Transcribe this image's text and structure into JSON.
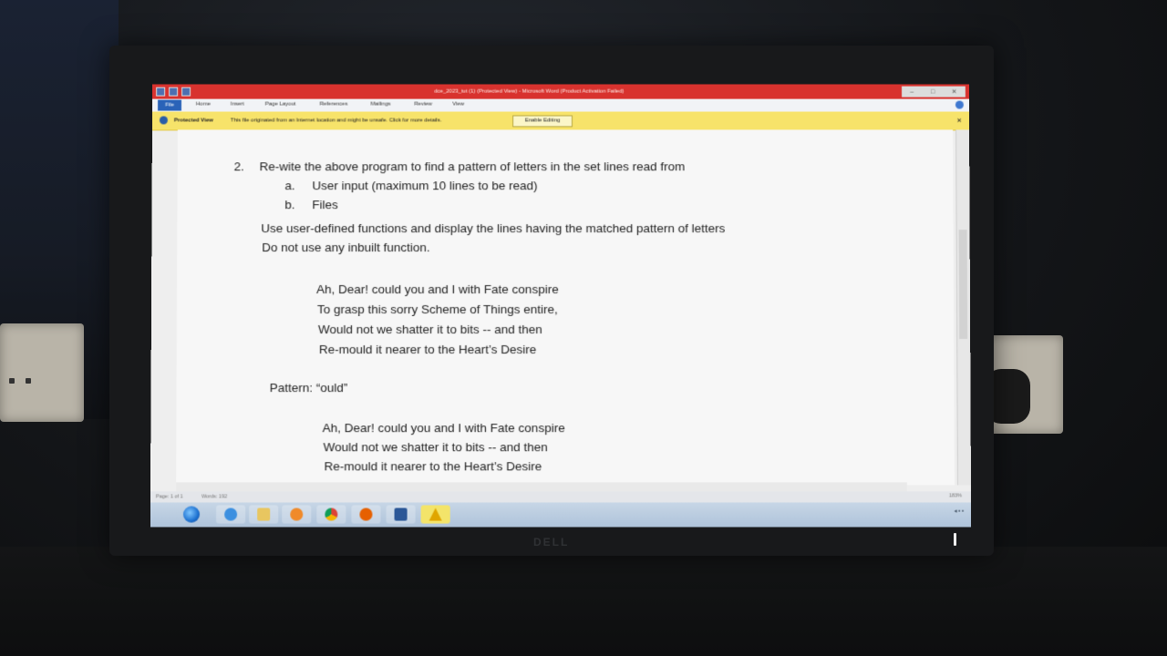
{
  "window": {
    "title": "dce_2023_tut (1) (Protected View) - Microsoft Word (Product Activation Failed)",
    "accent_color": "#d8322e"
  },
  "ribbon": {
    "tabs": [
      "File",
      "Home",
      "Insert",
      "Page Layout",
      "References",
      "Mailings",
      "Review",
      "View"
    ]
  },
  "protected_view": {
    "label": "Protected View",
    "message": "This file originated from an Internet location and might be unsafe. Click for more details.",
    "button": "Enable Editing",
    "bar_color": "#f7e36a"
  },
  "document": {
    "question_number": "2.",
    "question_text": "Re-wite the above program to find a pattern of letters in the set lines read from",
    "option_a_marker": "a.",
    "option_a_text": "User input (maximum 10 lines to be read)",
    "option_b_marker": "b.",
    "option_b_text": "Files",
    "instruction_1": "Use user-defined functions and display the lines having the matched pattern of letters",
    "instruction_2": "Do not use any inbuilt function.",
    "poem": [
      "Ah, Dear! could you and I with Fate conspire",
      "To grasp this sorry Scheme of Things entire,",
      "Would not we shatter it to bits -- and then",
      "Re-mould it nearer to the Heart’s Desire"
    ],
    "pattern_label": "Pattern: “ould”",
    "matched_lines": [
      "Ah, Dear! could you and I with Fate conspire",
      "Would not we shatter it to bits -- and then",
      "Re-mould it nearer to the Heart’s Desire"
    ]
  },
  "statusbar": {
    "page": "Page: 1 of 1",
    "words": "Words: 192",
    "zoom": "183%"
  },
  "taskbar": {
    "icons": [
      "start-orb",
      "internet-explorer-icon",
      "file-explorer-icon",
      "media-player-icon",
      "chrome-icon",
      "firefox-icon",
      "word-icon",
      "warning-icon"
    ]
  }
}
